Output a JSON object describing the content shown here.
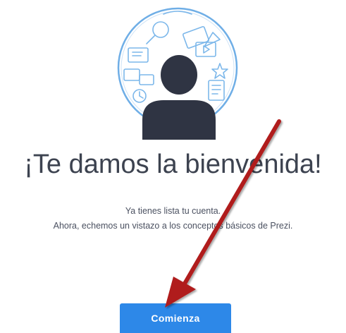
{
  "welcome": {
    "title": "¡Te damos la bienvenida!",
    "subtitle_line1": "Ya tienes lista tu cuenta.",
    "subtitle_line2": "Ahora, echemos un vistazo a los conceptos básicos de Prezi."
  },
  "actions": {
    "start_label": "Comienza"
  },
  "icons": {
    "hero": "user-avatar-with-doodles",
    "annotation": "red-arrow-pointing-to-button"
  },
  "colors": {
    "button": "#2d88e8",
    "title_text": "#3d4350",
    "avatar": "#2f3443",
    "circle_outline": "#6faee6",
    "annotation_arrow": "#b01c1c"
  }
}
